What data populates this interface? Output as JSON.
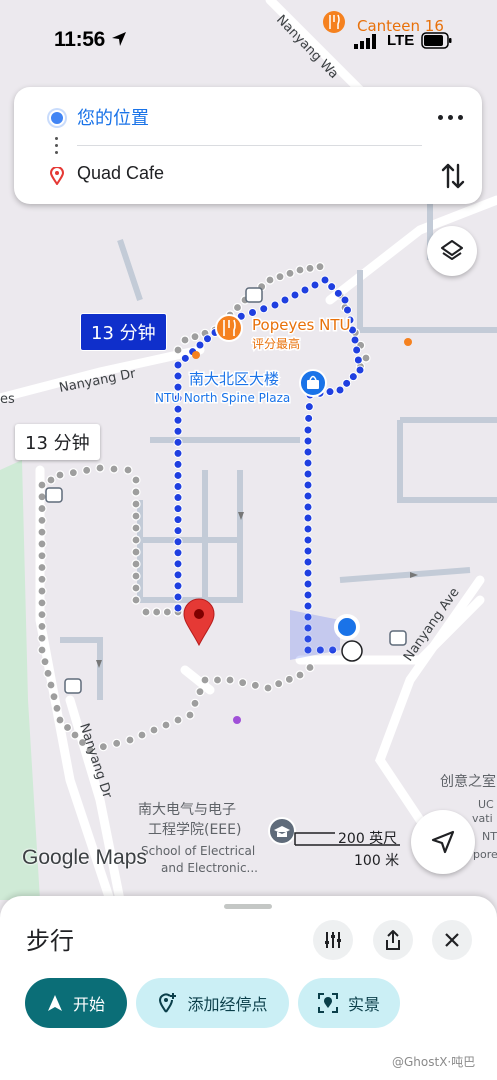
{
  "status": {
    "time": "11:56",
    "network": "LTE"
  },
  "route": {
    "origin": "您的位置",
    "destination": "Quad Cafe"
  },
  "map": {
    "labels": {
      "canteen": "Canteen 16",
      "popeyes": "Popeyes NTU",
      "popeyes_sub": "评分最高",
      "north_spine_cn": "南大北区大楼",
      "north_spine_en": "NTU North Spine Plaza",
      "nanyang_dr_1": "Nanyang Dr",
      "nanyang_dr_2": "Nanyang Dr",
      "nanyang_ave": "Nanyang Ave",
      "nanyang_wa": "Nanyang Wa",
      "eee_cn_1": "南大电气与电子",
      "eee_cn_2": "工程学院(EEE)",
      "eee_en_1": "School of Electrical",
      "eee_en_2": "and Electronic...",
      "chuangyi": "创意之室",
      "edge_es": "es",
      "edge_uc": "UC",
      "edge_vati": "vati",
      "edge_nt": "NT",
      "edge_pore": "pore"
    },
    "time_primary": "13 分钟",
    "time_alternate": "13 分钟",
    "google_logo": "Google Maps",
    "scale_ft": "200 英尺",
    "scale_m": "100 米"
  },
  "sheet": {
    "mode": "步行",
    "start_label": "开始",
    "add_stop_label": "添加经停点",
    "live_view_label": "实景"
  },
  "watermark": "@GhostX·吨巴",
  "colors": {
    "route_blue": "#1f3fe0",
    "alt_gray": "#9e9e9e",
    "pin_red": "#e53935",
    "start_teal": "#0b6e77",
    "pill_bg": "#cbeff5"
  },
  "icons": [
    "navigation-arrow-icon",
    "signal-icon",
    "battery-icon",
    "location-pin-icon",
    "more-icon",
    "swap-icon",
    "layers-icon",
    "restaurant-icon",
    "shopping-icon",
    "bus-stop-icon",
    "school-icon",
    "my-location-icon",
    "sliders-icon",
    "share-icon",
    "close-icon",
    "add-location-icon",
    "live-view-icon"
  ]
}
